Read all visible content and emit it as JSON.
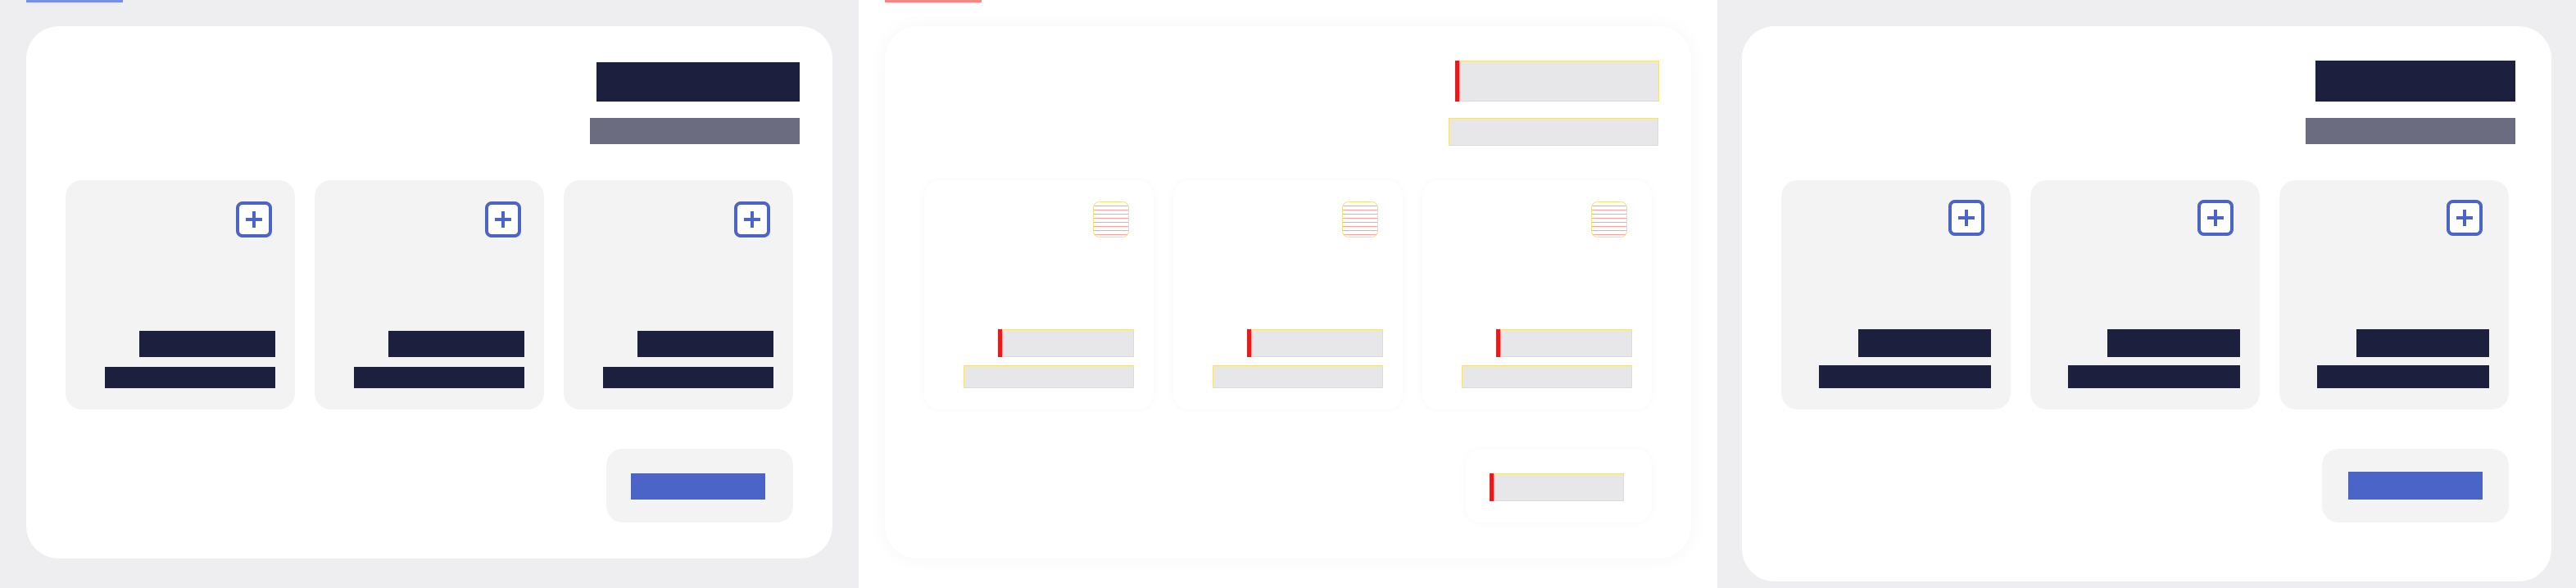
{
  "panels": [
    {
      "variant": "dark",
      "accent": "#4a65c7",
      "title": "",
      "subtitle": "",
      "tiles": [
        {
          "icon": "plus-square-icon",
          "line1": "",
          "line2": ""
        },
        {
          "icon": "plus-square-icon",
          "line1": "",
          "line2": ""
        },
        {
          "icon": "plus-square-icon",
          "line1": "",
          "line2": ""
        }
      ],
      "button_label": ""
    },
    {
      "variant": "wireframe",
      "accent": "#e11d1d",
      "title": "",
      "subtitle": "",
      "tiles": [
        {
          "icon": "placeholder-icon",
          "line1": "",
          "line2": ""
        },
        {
          "icon": "placeholder-icon",
          "line1": "",
          "line2": ""
        },
        {
          "icon": "placeholder-icon",
          "line1": "",
          "line2": ""
        }
      ],
      "button_label": ""
    },
    {
      "variant": "dark",
      "accent": "#4a65c7",
      "title": "",
      "subtitle": "",
      "tiles": [
        {
          "icon": "plus-square-icon",
          "line1": "",
          "line2": ""
        },
        {
          "icon": "plus-square-icon",
          "line1": "",
          "line2": ""
        },
        {
          "icon": "plus-square-icon",
          "line1": "",
          "line2": ""
        }
      ],
      "button_label": ""
    }
  ],
  "colors": {
    "card_bg": "#ffffff",
    "tile_bg": "#f3f3f4",
    "dark_text": "#1c1f3d",
    "muted_text": "#6b6c80",
    "primary": "#4a65c7",
    "wireframe_red": "#e11d1d",
    "wireframe_yellow": "#f2e27a"
  }
}
